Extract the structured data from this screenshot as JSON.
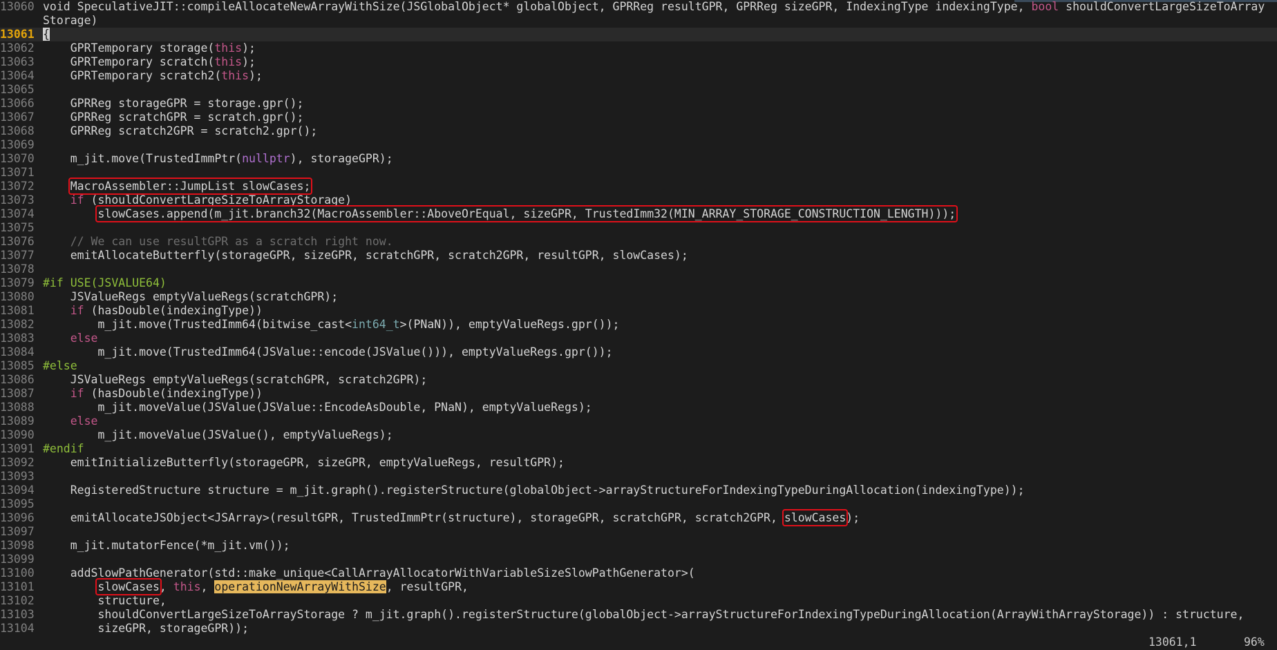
{
  "editor": {
    "lines": [
      {
        "n": "13060",
        "t": "void SpeculativeJIT::compileAllocateNewArrayWithSize(JSGlobalObject* globalObject, GPRReg resultGPR, GPRReg sizeGPR, IndexingType indexingType, bool shouldConvertLargeSizeToArray"
      },
      {
        "n": "",
        "t": "Storage)"
      },
      {
        "n": "13061",
        "t": "{",
        "cursor": true
      },
      {
        "n": "13062",
        "t": "    GPRTemporary storage(this);"
      },
      {
        "n": "13063",
        "t": "    GPRTemporary scratch(this);"
      },
      {
        "n": "13064",
        "t": "    GPRTemporary scratch2(this);"
      },
      {
        "n": "13065",
        "t": ""
      },
      {
        "n": "13066",
        "t": "    GPRReg storageGPR = storage.gpr();"
      },
      {
        "n": "13067",
        "t": "    GPRReg scratchGPR = scratch.gpr();"
      },
      {
        "n": "13068",
        "t": "    GPRReg scratch2GPR = scratch2.gpr();"
      },
      {
        "n": "13069",
        "t": ""
      },
      {
        "n": "13070",
        "t": "    m_jit.move(TrustedImmPtr(nullptr), storageGPR);"
      },
      {
        "n": "13071",
        "t": ""
      },
      {
        "n": "13072",
        "t": "    MacroAssembler::JumpList slowCases;"
      },
      {
        "n": "13073",
        "t": "    if (shouldConvertLargeSizeToArrayStorage)"
      },
      {
        "n": "13074",
        "t": "        slowCases.append(m_jit.branch32(MacroAssembler::AboveOrEqual, sizeGPR, TrustedImm32(MIN_ARRAY_STORAGE_CONSTRUCTION_LENGTH)));"
      },
      {
        "n": "13075",
        "t": ""
      },
      {
        "n": "13076",
        "t": "    // We can use resultGPR as a scratch right now."
      },
      {
        "n": "13077",
        "t": "    emitAllocateButterfly(storageGPR, sizeGPR, scratchGPR, scratch2GPR, resultGPR, slowCases);"
      },
      {
        "n": "13078",
        "t": ""
      },
      {
        "n": "13079",
        "t": "#if USE(JSVALUE64)"
      },
      {
        "n": "13080",
        "t": "    JSValueRegs emptyValueRegs(scratchGPR);"
      },
      {
        "n": "13081",
        "t": "    if (hasDouble(indexingType))"
      },
      {
        "n": "13082",
        "t": "        m_jit.move(TrustedImm64(bitwise_cast<int64_t>(PNaN)), emptyValueRegs.gpr());"
      },
      {
        "n": "13083",
        "t": "    else"
      },
      {
        "n": "13084",
        "t": "        m_jit.move(TrustedImm64(JSValue::encode(JSValue())), emptyValueRegs.gpr());"
      },
      {
        "n": "13085",
        "t": "#else"
      },
      {
        "n": "13086",
        "t": "    JSValueRegs emptyValueRegs(scratchGPR, scratch2GPR);"
      },
      {
        "n": "13087",
        "t": "    if (hasDouble(indexingType))"
      },
      {
        "n": "13088",
        "t": "        m_jit.moveValue(JSValue(JSValue::EncodeAsDouble, PNaN), emptyValueRegs);"
      },
      {
        "n": "13089",
        "t": "    else"
      },
      {
        "n": "13090",
        "t": "        m_jit.moveValue(JSValue(), emptyValueRegs);"
      },
      {
        "n": "13091",
        "t": "#endif"
      },
      {
        "n": "13092",
        "t": "    emitInitializeButterfly(storageGPR, sizeGPR, emptyValueRegs, resultGPR);"
      },
      {
        "n": "13093",
        "t": ""
      },
      {
        "n": "13094",
        "t": "    RegisteredStructure structure = m_jit.graph().registerStructure(globalObject->arrayStructureForIndexingTypeDuringAllocation(indexingType));"
      },
      {
        "n": "13095",
        "t": ""
      },
      {
        "n": "13096",
        "t": "    emitAllocateJSObject<JSArray>(resultGPR, TrustedImmPtr(structure), storageGPR, scratchGPR, scratch2GPR, slowCases);"
      },
      {
        "n": "13097",
        "t": ""
      },
      {
        "n": "13098",
        "t": "    m_jit.mutatorFence(*m_jit.vm());"
      },
      {
        "n": "13099",
        "t": ""
      },
      {
        "n": "13100",
        "t": "    addSlowPathGenerator(std::make_unique<CallArrayAllocatorWithVariableSizeSlowPathGenerator>("
      },
      {
        "n": "13101",
        "t": "        slowCases, this, operationNewArrayWithSize, resultGPR,"
      },
      {
        "n": "13102",
        "t": "        structure,"
      },
      {
        "n": "13103",
        "t": "        shouldConvertLargeSizeToArrayStorage ? m_jit.graph().registerStructure(globalObject->arrayStructureForIndexingTypeDuringAllocation(ArrayWithArrayStorage)) : structure,"
      },
      {
        "n": "13104",
        "t": "        sizeGPR, storageGPR));"
      }
    ]
  },
  "status": {
    "position": "13061,1",
    "percent": "96%"
  }
}
